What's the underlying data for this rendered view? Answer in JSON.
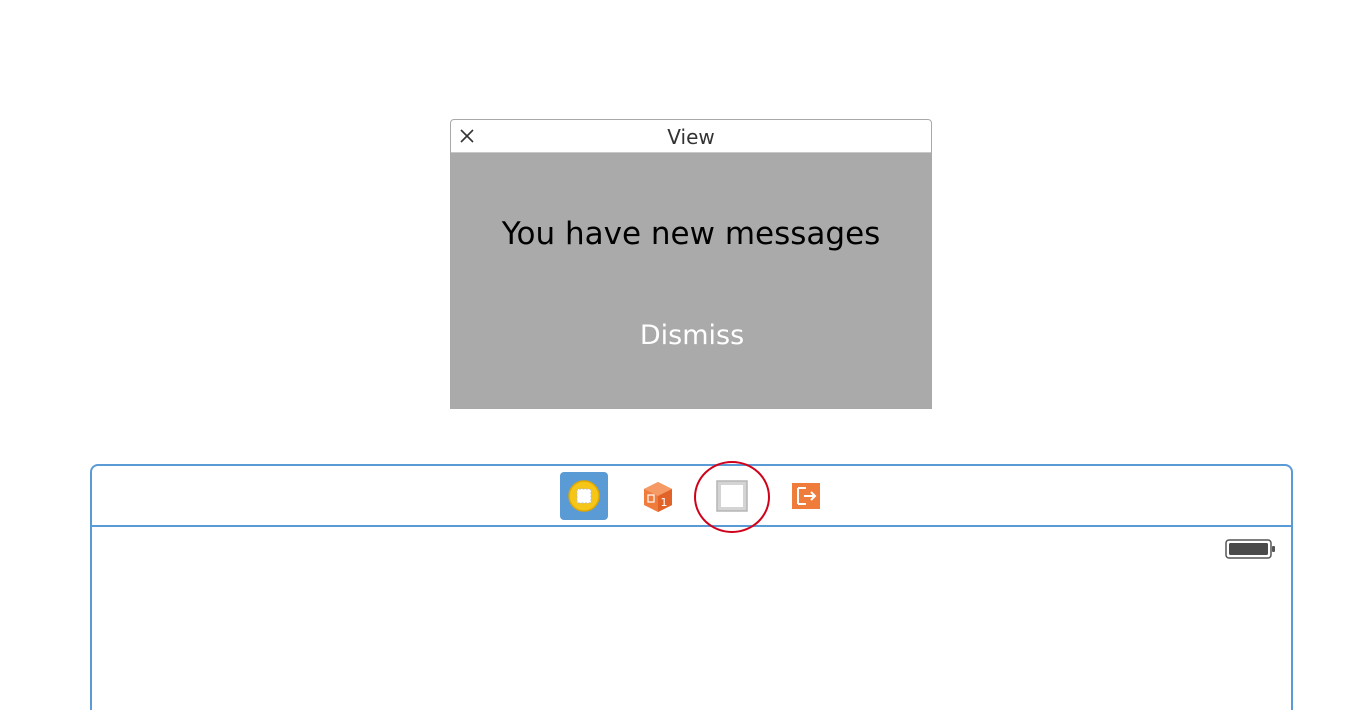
{
  "view_panel": {
    "title": "View",
    "close_icon": "close-icon",
    "message": "You have new messages",
    "dismiss_label": "Dismiss",
    "body_color": "#aaaaaa"
  },
  "scene": {
    "accent_color": "#5b9bd5",
    "dock_items": [
      {
        "icon": "view-controller-icon",
        "selected": true
      },
      {
        "icon": "first-responder-icon",
        "selected": false
      },
      {
        "icon": "view-object-icon",
        "selected": false,
        "highlighted": true
      },
      {
        "icon": "exit-icon",
        "selected": false
      }
    ],
    "status_bar": {
      "battery_icon": "battery-icon"
    }
  },
  "annotation": {
    "highlight_color": "#d0021b"
  }
}
